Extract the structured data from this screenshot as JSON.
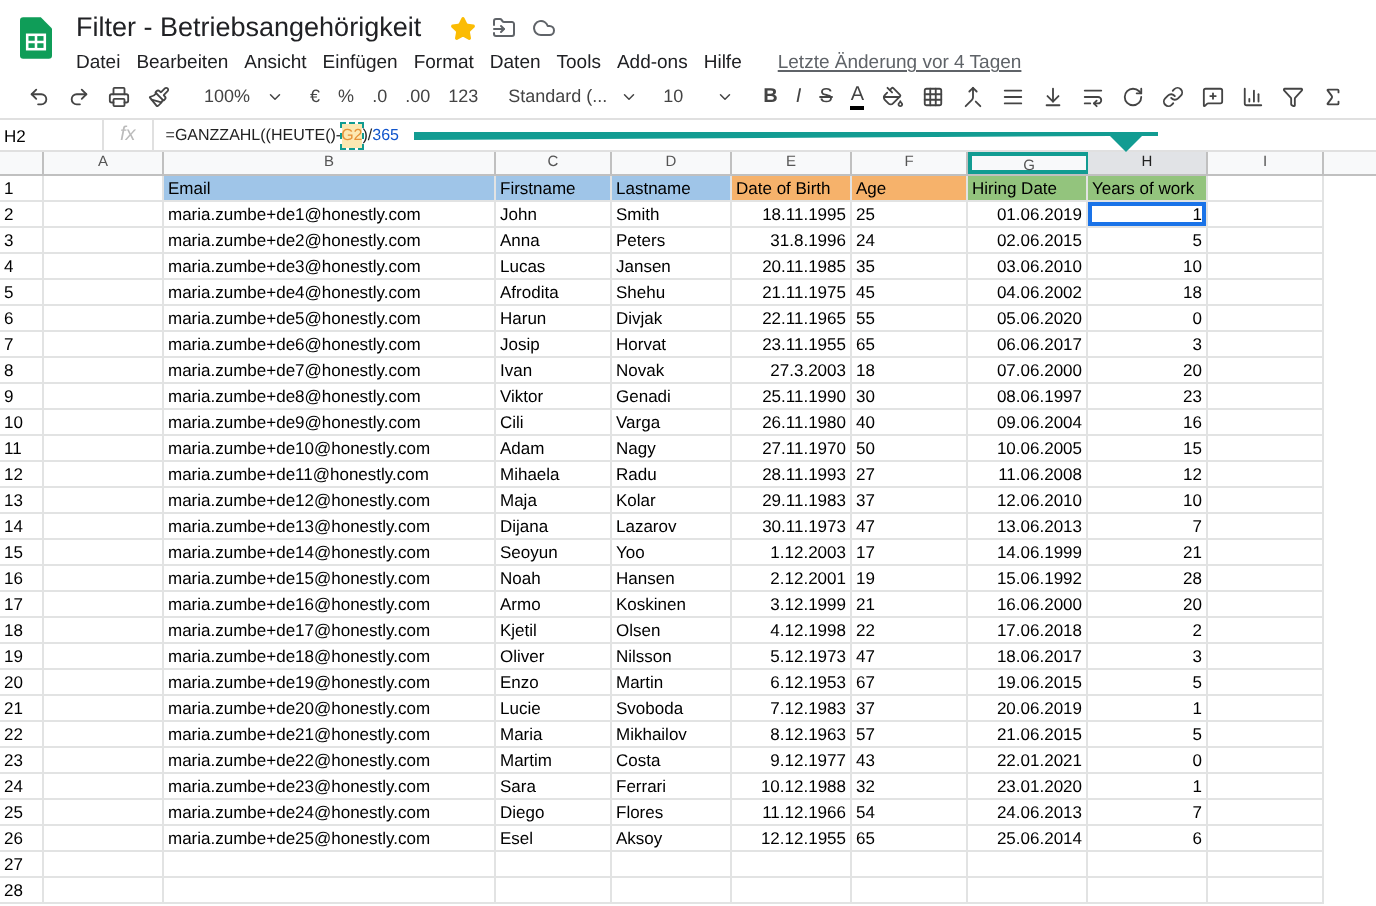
{
  "document": {
    "title": "Filter - Betriebsangehörigkeit",
    "starred": true
  },
  "menu": [
    "Datei",
    "Bearbeiten",
    "Ansicht",
    "Einfügen",
    "Format",
    "Daten",
    "Tools",
    "Add-ons",
    "Hilfe"
  ],
  "last_edit": "Letzte Änderung vor 4 Tagen",
  "toolbar": {
    "zoom": "100%",
    "currency": "€",
    "percent": "%",
    "decimal_less": ".0",
    "decimal_more": ".00",
    "number_format": "123",
    "font": "Standard (...",
    "font_size": "10",
    "bold": "B",
    "italic": "I",
    "strike": "S",
    "text_color": "A"
  },
  "formula_bar": {
    "cell": "H2",
    "fx": "fx",
    "parts": [
      {
        "text": "=GANZZAHL((HEUTE()-",
        "kind": "plain"
      },
      {
        "text": "G2",
        "kind": "ref"
      },
      {
        "text": ")/",
        "kind": "plain"
      },
      {
        "text": "365",
        "kind": "number"
      }
    ]
  },
  "columns": [
    {
      "label": "A",
      "selected": false
    },
    {
      "label": "B",
      "selected": false
    },
    {
      "label": "C",
      "selected": false
    },
    {
      "label": "D",
      "selected": false
    },
    {
      "label": "E",
      "selected": false
    },
    {
      "label": "F",
      "selected": false
    },
    {
      "label": "G",
      "selected": false,
      "highlighted": true
    },
    {
      "label": "H",
      "selected": true
    },
    {
      "label": "I",
      "selected": false
    }
  ],
  "header": {
    "row": "1",
    "cells": [
      {
        "text": "Email",
        "color": "#9fc5e8"
      },
      {
        "text": "Firstname",
        "color": "#9fc5e8"
      },
      {
        "text": "Lastname",
        "color": "#9fc5e8"
      },
      {
        "text": "Date of Birth",
        "color": "#f6b26b"
      },
      {
        "text": "Age",
        "color": "#f6b26b"
      },
      {
        "text": "Hiring Date",
        "color": "#93c47d"
      },
      {
        "text": "Years of work",
        "color": "#93c47d"
      }
    ]
  },
  "rows": [
    {
      "row": "2",
      "email": "maria.zumbe+de1@honestly.com",
      "firstname": "John",
      "lastname": "Smith",
      "birth": "18.11.1995",
      "age": "25",
      "hiring": "01.06.2019",
      "years": "1",
      "selected": true
    },
    {
      "row": "3",
      "email": "maria.zumbe+de2@honestly.com",
      "firstname": "Anna",
      "lastname": "Peters",
      "birth": "31.8.1996",
      "age": "24",
      "hiring": "02.06.2015",
      "years": "5",
      "selected": false
    },
    {
      "row": "4",
      "email": "maria.zumbe+de3@honestly.com",
      "firstname": "Lucas",
      "lastname": "Jansen",
      "birth": "20.11.1985",
      "age": "35",
      "hiring": "03.06.2010",
      "years": "10",
      "selected": false
    },
    {
      "row": "5",
      "email": "maria.zumbe+de4@honestly.com",
      "firstname": "Afrodita",
      "lastname": "Shehu",
      "birth": "21.11.1975",
      "age": "45",
      "hiring": "04.06.2002",
      "years": "18",
      "selected": false
    },
    {
      "row": "6",
      "email": "maria.zumbe+de5@honestly.com",
      "firstname": "Harun",
      "lastname": "Divjak",
      "birth": "22.11.1965",
      "age": "55",
      "hiring": "05.06.2020",
      "years": "0",
      "selected": false
    },
    {
      "row": "7",
      "email": "maria.zumbe+de6@honestly.com",
      "firstname": "Josip",
      "lastname": "Horvat",
      "birth": "23.11.1955",
      "age": "65",
      "hiring": "06.06.2017",
      "years": "3",
      "selected": false
    },
    {
      "row": "8",
      "email": "maria.zumbe+de7@honestly.com",
      "firstname": "Ivan",
      "lastname": "Novak",
      "birth": "27.3.2003",
      "age": "18",
      "hiring": "07.06.2000",
      "years": "20",
      "selected": false
    },
    {
      "row": "9",
      "email": "maria.zumbe+de8@honestly.com",
      "firstname": "Viktor",
      "lastname": "Genadi",
      "birth": "25.11.1990",
      "age": "30",
      "hiring": "08.06.1997",
      "years": "23",
      "selected": false
    },
    {
      "row": "10",
      "email": "maria.zumbe+de9@honestly.com",
      "firstname": "Cili",
      "lastname": "Varga",
      "birth": "26.11.1980",
      "age": "40",
      "hiring": "09.06.2004",
      "years": "16",
      "selected": false
    },
    {
      "row": "11",
      "email": "maria.zumbe+de10@honestly.com",
      "firstname": "Adam",
      "lastname": "Nagy",
      "birth": "27.11.1970",
      "age": "50",
      "hiring": "10.06.2005",
      "years": "15",
      "selected": false
    },
    {
      "row": "12",
      "email": "maria.zumbe+de11@honestly.com",
      "firstname": "Mihaela",
      "lastname": "Radu",
      "birth": "28.11.1993",
      "age": "27",
      "hiring": "11.06.2008",
      "years": "12",
      "selected": false
    },
    {
      "row": "13",
      "email": "maria.zumbe+de12@honestly.com",
      "firstname": "Maja",
      "lastname": "Kolar",
      "birth": "29.11.1983",
      "age": "37",
      "hiring": "12.06.2010",
      "years": "10",
      "selected": false
    },
    {
      "row": "14",
      "email": "maria.zumbe+de13@honestly.com",
      "firstname": "Dijana",
      "lastname": "Lazarov",
      "birth": "30.11.1973",
      "age": "47",
      "hiring": "13.06.2013",
      "years": "7",
      "selected": false
    },
    {
      "row": "15",
      "email": "maria.zumbe+de14@honestly.com",
      "firstname": "Seoyun",
      "lastname": "Yoo",
      "birth": "1.12.2003",
      "age": "17",
      "hiring": "14.06.1999",
      "years": "21",
      "selected": false
    },
    {
      "row": "16",
      "email": "maria.zumbe+de15@honestly.com",
      "firstname": "Noah",
      "lastname": "Hansen",
      "birth": "2.12.2001",
      "age": "19",
      "hiring": "15.06.1992",
      "years": "28",
      "selected": false
    },
    {
      "row": "17",
      "email": "maria.zumbe+de16@honestly.com",
      "firstname": "Armo",
      "lastname": "Koskinen",
      "birth": "3.12.1999",
      "age": "21",
      "hiring": "16.06.2000",
      "years": "20",
      "selected": false
    },
    {
      "row": "18",
      "email": "maria.zumbe+de17@honestly.com",
      "firstname": "Kjetil",
      "lastname": "Olsen",
      "birth": "4.12.1998",
      "age": "22",
      "hiring": "17.06.2018",
      "years": "2",
      "selected": false
    },
    {
      "row": "19",
      "email": "maria.zumbe+de18@honestly.com",
      "firstname": "Oliver",
      "lastname": "Nilsson",
      "birth": "5.12.1973",
      "age": "47",
      "hiring": "18.06.2017",
      "years": "3",
      "selected": false
    },
    {
      "row": "20",
      "email": "maria.zumbe+de19@honestly.com",
      "firstname": "Enzo",
      "lastname": "Martin",
      "birth": "6.12.1953",
      "age": "67",
      "hiring": "19.06.2015",
      "years": "5",
      "selected": false
    },
    {
      "row": "21",
      "email": "maria.zumbe+de20@honestly.com",
      "firstname": "Lucie",
      "lastname": "Svoboda",
      "birth": "7.12.1983",
      "age": "37",
      "hiring": "20.06.2019",
      "years": "1",
      "selected": false
    },
    {
      "row": "22",
      "email": "maria.zumbe+de21@honestly.com",
      "firstname": "Maria",
      "lastname": "Mikhailov",
      "birth": "8.12.1963",
      "age": "57",
      "hiring": "21.06.2015",
      "years": "5",
      "selected": false
    },
    {
      "row": "23",
      "email": "maria.zumbe+de22@honestly.com",
      "firstname": "Martim",
      "lastname": "Costa",
      "birth": "9.12.1977",
      "age": "43",
      "hiring": "22.01.2021",
      "years": "0",
      "selected": false
    },
    {
      "row": "24",
      "email": "maria.zumbe+de23@honestly.com",
      "firstname": "Sara",
      "lastname": "Ferrari",
      "birth": "10.12.1988",
      "age": "32",
      "hiring": "23.01.2020",
      "years": "1",
      "selected": false
    },
    {
      "row": "25",
      "email": "maria.zumbe+de24@honestly.com",
      "firstname": "Diego",
      "lastname": "Flores",
      "birth": "11.12.1966",
      "age": "54",
      "hiring": "24.06.2013",
      "years": "7",
      "selected": false
    },
    {
      "row": "26",
      "email": "maria.zumbe+de25@honestly.com",
      "firstname": "Esel",
      "lastname": "Aksoy",
      "birth": "12.12.1955",
      "age": "65",
      "hiring": "25.06.2014",
      "years": "6",
      "selected": false
    }
  ],
  "empty_rows": [
    "27",
    "28"
  ]
}
